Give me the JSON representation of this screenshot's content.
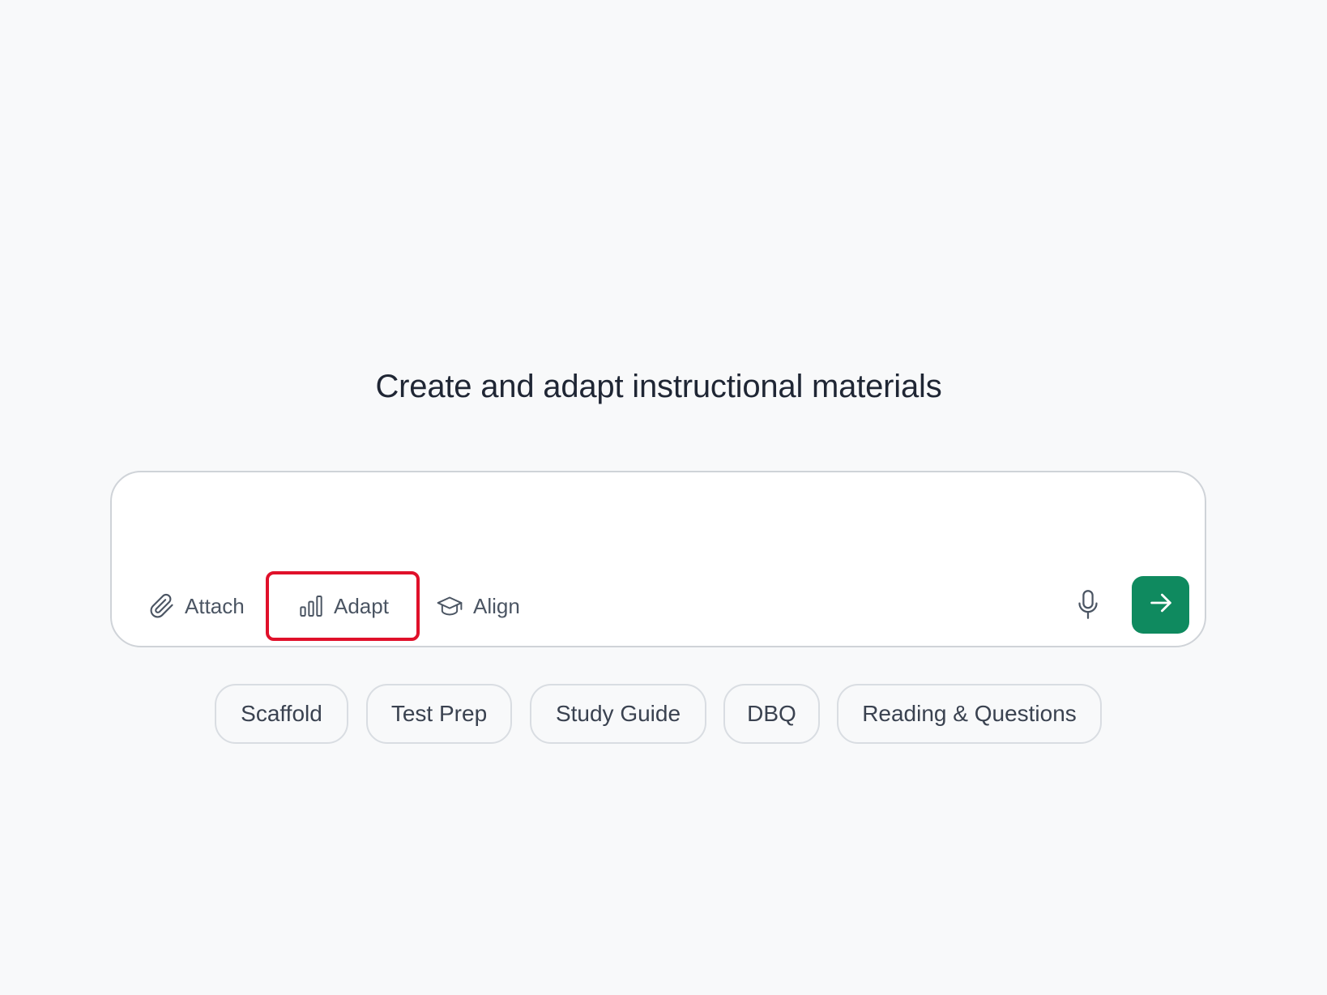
{
  "heading": "Create and adapt instructional materials",
  "composer": {
    "input_value": "",
    "tools": {
      "attach_label": "Attach",
      "adapt_label": "Adapt",
      "align_label": "Align"
    },
    "icons": {
      "attach": "paperclip-icon",
      "adapt": "bar-chart-icon",
      "align": "graduation-cap-icon",
      "mic": "microphone-icon",
      "send": "arrow-right-icon"
    },
    "highlight_color": "#e0102a",
    "send_color": "#0f8a5f"
  },
  "suggestions": [
    "Scaffold",
    "Test Prep",
    "Study Guide",
    "DBQ",
    "Reading & Questions"
  ]
}
